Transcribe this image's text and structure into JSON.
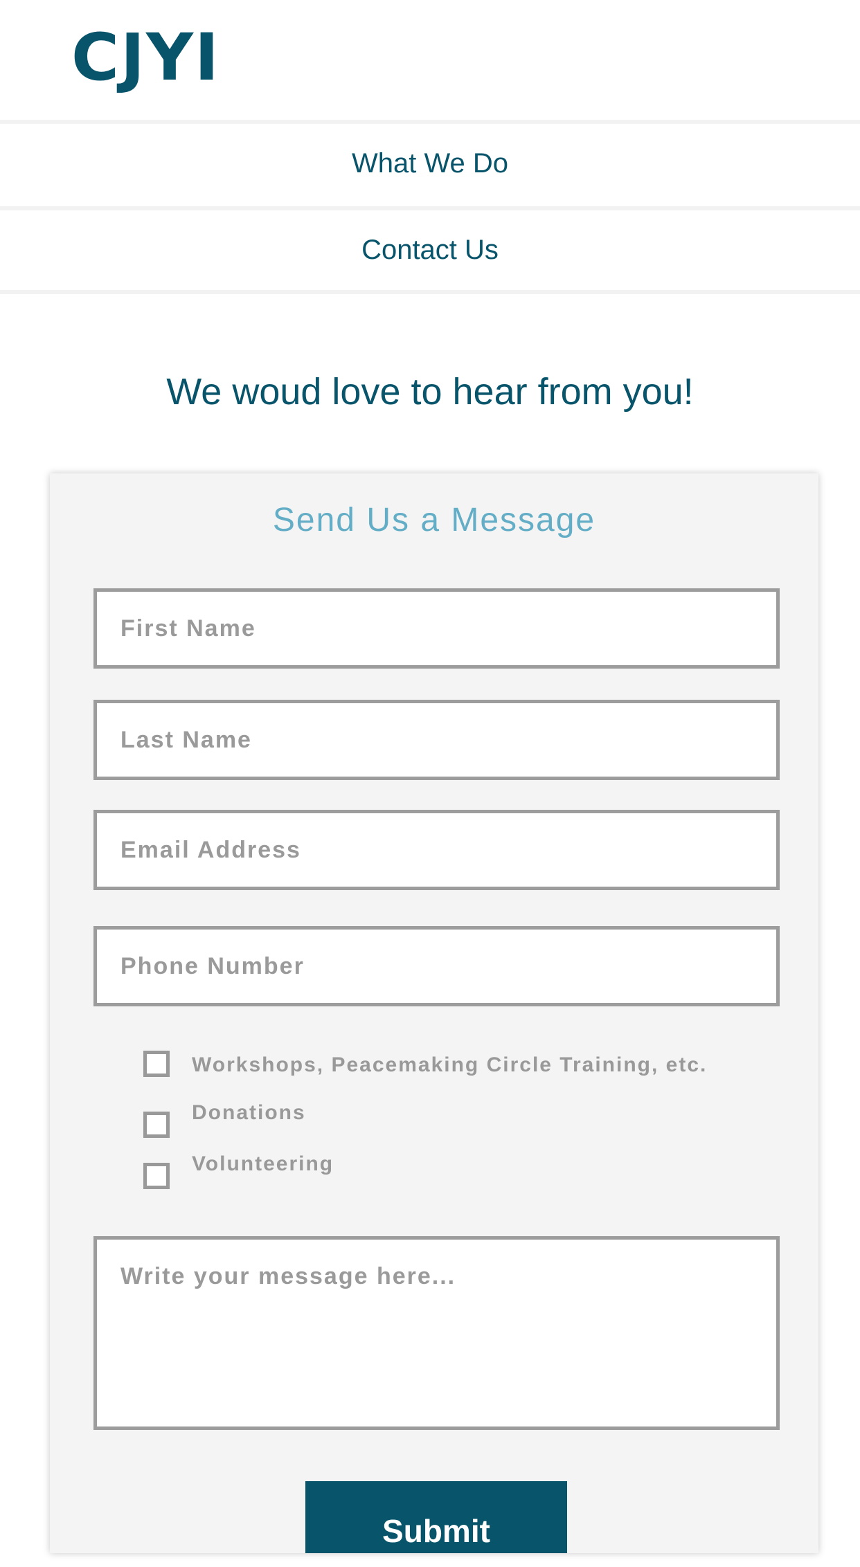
{
  "header": {
    "logo_text": "CJYI"
  },
  "nav": {
    "items": [
      {
        "label": "What We Do"
      },
      {
        "label": "Contact Us"
      }
    ]
  },
  "main": {
    "headline": "We woud love to hear from you!"
  },
  "form": {
    "title": "Send Us a Message",
    "fields": {
      "first_name": {
        "placeholder": "First Name",
        "value": ""
      },
      "last_name": {
        "placeholder": "Last Name",
        "value": ""
      },
      "email": {
        "placeholder": "Email Address",
        "value": ""
      },
      "phone": {
        "placeholder": "Phone Number",
        "value": ""
      },
      "message": {
        "placeholder": "Write your message here...",
        "value": ""
      }
    },
    "checkboxes": [
      {
        "label": "Workshops, Peacemaking Circle Training, etc.",
        "checked": false
      },
      {
        "label": "Donations",
        "checked": false
      },
      {
        "label": "Volunteering",
        "checked": false
      }
    ],
    "submit_label": "Submit"
  },
  "colors": {
    "brand": "#08546b",
    "accent": "#63aec6",
    "field_border": "#9c9c9c",
    "card_bg": "#f4f4f4"
  }
}
